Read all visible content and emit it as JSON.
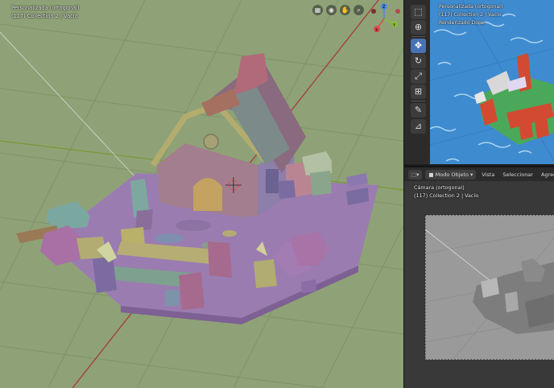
{
  "main_viewport": {
    "view_label": "Personalizada (ortogonal)",
    "collection_label": "(117) Collection 2 | Vacío",
    "nav_buttons": [
      {
        "icon": "grid-icon",
        "glyph": "▦"
      },
      {
        "icon": "camera-icon",
        "glyph": "◉"
      },
      {
        "icon": "hand-icon",
        "glyph": "✋"
      },
      {
        "icon": "zoom-icon",
        "glyph": "⌕"
      }
    ],
    "gizmo": {
      "x_label": "X",
      "y_label": "Y",
      "z_label": "Z"
    },
    "colors": {
      "floor": "#8fa277",
      "grid_line": "#7e9168",
      "house_roof": "#a8746c",
      "walls": "#a37e8e",
      "purple_base": "#9a7cb1"
    }
  },
  "toolbar": {
    "tools": [
      {
        "name": "select-box-tool",
        "glyph": "⬚",
        "active": false
      },
      {
        "name": "cursor-tool",
        "glyph": "⊕",
        "active": false
      },
      {
        "name": "move-tool",
        "glyph": "✥",
        "active": true
      },
      {
        "name": "rotate-tool",
        "glyph": "↻",
        "active": false
      },
      {
        "name": "scale-tool",
        "glyph": "⤢",
        "active": false
      },
      {
        "name": "transform-tool",
        "glyph": "⊞",
        "active": false
      },
      {
        "name": "annotate-tool",
        "glyph": "✎",
        "active": false
      },
      {
        "name": "measure-tool",
        "glyph": "⊿",
        "active": false
      }
    ]
  },
  "render_viewport": {
    "view_label": "Personalizada (ortogonal)",
    "collection_label": "(117) Collection 2 | Vacío",
    "status_label": "Renderizado Done"
  },
  "camera_editor": {
    "header": {
      "mode_label": "Modo Objeto",
      "menu_view": "Vista",
      "menu_select": "Seleccionar",
      "menu_add": "Agregar"
    },
    "view_label": "Cámara (ortogonal)",
    "collection_label": "(117) Collection 2 | Vacío"
  }
}
